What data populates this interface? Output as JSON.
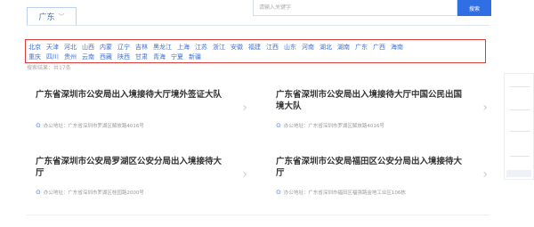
{
  "location_tab": {
    "label": "广东",
    "icon": "chevron-down-icon"
  },
  "search": {
    "placeholder": "请输入关键字",
    "button_label": "搜索"
  },
  "regions": {
    "row1": [
      "北京",
      "天津",
      "河北",
      "山西",
      "内蒙",
      "辽宁",
      "吉林",
      "黑龙江",
      "上海",
      "江苏",
      "浙江",
      "安徽",
      "福建",
      "江西",
      "山东",
      "河南",
      "湖北",
      "湖南",
      "广东",
      "广西",
      "海南"
    ],
    "row2": [
      "重庆",
      "四川",
      "贵州",
      "云南",
      "西藏",
      "陕西",
      "甘肃",
      "青海",
      "宁夏",
      "新疆"
    ]
  },
  "result_count": "搜索结果：共17条",
  "cards": [
    {
      "title": "广东省深圳市公安局出入境接待大厅境外签证大队",
      "address": "办公地址：广东省深圳市罗湖区解放路4016号"
    },
    {
      "title": "广东省深圳市公安局出入境接待大厅中国公民出国境大队",
      "address": "办公地址：广东省深圳市罗湖区解放路4016号"
    },
    {
      "title": "广东省深圳市公安局罗湖区公安分局出入境接待大厅",
      "address": "办公地址：广东省深圳市罗湖区桂园路2000号"
    },
    {
      "title": "广东省深圳市公安局福田区公安分局出入境接待大厅",
      "address": "办公地址：广东省深圳市福田区福强路金地工业区106栋"
    }
  ]
}
